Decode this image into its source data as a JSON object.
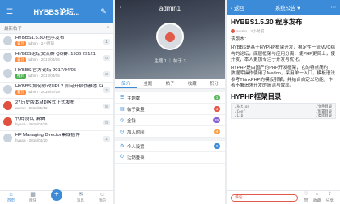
{
  "p1": {
    "title": "HYBBS论坛...",
    "search": "最新帖子",
    "threads": [
      {
        "title": "HYBBS1.5.30 程序发布",
        "tag": "置顶",
        "meta": "admin · 2小时前",
        "count": "1"
      },
      {
        "title": "HYBBS论坛交流群 QQ群: 1936 29121",
        "tag": "置顶",
        "meta": "admin · 2017/04/06",
        "count": "0"
      },
      {
        "title": "HYBBS 官方论坛 2017/04/05",
        "tag": "推荐",
        "meta": "admin · 2017/04/05",
        "count": "3"
      },
      {
        "title": "HYBBS 如何修改URL? 如何开启伪静态 FAQ",
        "tag": "置顶",
        "meta": "admin · 2016/07/29",
        "count": "2"
      },
      {
        "title": "27历史版本MD格式正式发布",
        "tag": "",
        "meta": "admin · 2016/05/12",
        "count": "5"
      },
      {
        "title": "代码测试 编辑",
        "tag": "",
        "meta": "hyaaa · 2016/04/25",
        "count": "0"
      },
      {
        "title": "HF Managing Director集成插件",
        "tag": "",
        "meta": "hyaaa · 2016/04/20",
        "count": "1"
      }
    ],
    "tabs": [
      "首页",
      "版块",
      "发布",
      "消息",
      "我的"
    ]
  },
  "p2": {
    "title": "admin1",
    "stats": "主题 1 ｜ 帖子 3",
    "tabs": [
      "简介",
      "主题",
      "帖子",
      "收藏",
      "积分"
    ],
    "items": [
      {
        "label": "主题数",
        "badge": "1"
      },
      {
        "label": "帖子数量",
        "badge": "3"
      },
      {
        "label": "金钱",
        "badge": "29"
      },
      {
        "label": "加入时间",
        "badge": "4"
      },
      {
        "label": "个人设置",
        "badge": "0"
      },
      {
        "label": "注销登录",
        "badge": ""
      }
    ]
  },
  "p3": {
    "back": "‹ 返回",
    "forum": "系统公告 ▾",
    "title": "HYBBS1.5.30 程序发布",
    "author": "admin · 2小时前",
    "p1": "该版本：",
    "p2": "HYBBS是基于HYPHP框架开发，稳定性一流MVC结构的论坛，底层框架与应用分离，使PHP更简上，使开发，本人更加专注于开发与优化。",
    "p3": "HYPHP是由国产的PHP开发框架，它的特点简约，数据库操作使用了Medoo，采用单一入口，模板语法参考ThinkPHP的模板引擎，并结合自定义功能，作者不懈追求开发的简洁与效率。",
    "h2": "HYPHP框架目录",
    "code_l": [
      "/Action",
      "/Conf",
      "/Lib"
    ],
    "code_r": [
      "/文件目录",
      "/配置目录",
      "/类库目录"
    ],
    "comment": "评论",
    "icons": [
      "赞",
      "收藏",
      "分享"
    ]
  }
}
